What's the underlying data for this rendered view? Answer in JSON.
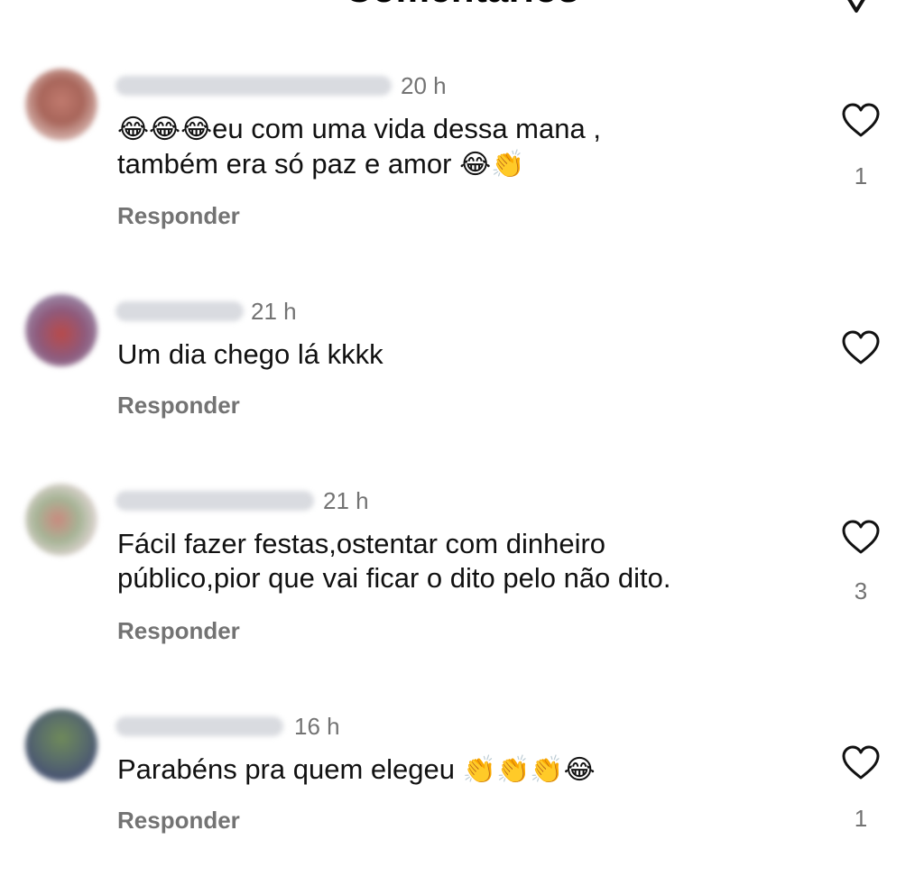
{
  "header": {
    "title": "Comentários"
  },
  "comments": [
    {
      "time": "20 h",
      "text_line1_emoji": "😂😂😂",
      "text_line1": "eu com uma vida dessa mana ,",
      "text_line2": "também era só paz e amor ",
      "text_line2_emoji": "😂👏",
      "reply_label": "Responder",
      "likes": "1"
    },
    {
      "time": "21 h",
      "text_line1": "Um dia chego lá kkkk",
      "reply_label": "Responder",
      "likes": ""
    },
    {
      "time": "21 h",
      "text_line1": "Fácil fazer festas,ostentar com dinheiro",
      "text_line2": "público,pior que vai ficar o dito pelo não dito.",
      "reply_label": "Responder",
      "likes": "3"
    },
    {
      "time": "16 h",
      "text_line1": "Parabéns pra quem elegeu ",
      "text_line1_emoji": "👏👏👏😂",
      "reply_label": "Responder",
      "likes": "1"
    }
  ],
  "colors": {
    "secondary_text": "#737373",
    "primary_text": "#111111",
    "background": "#ffffff"
  },
  "icons": [
    "heart-icon",
    "filter-icon"
  ]
}
